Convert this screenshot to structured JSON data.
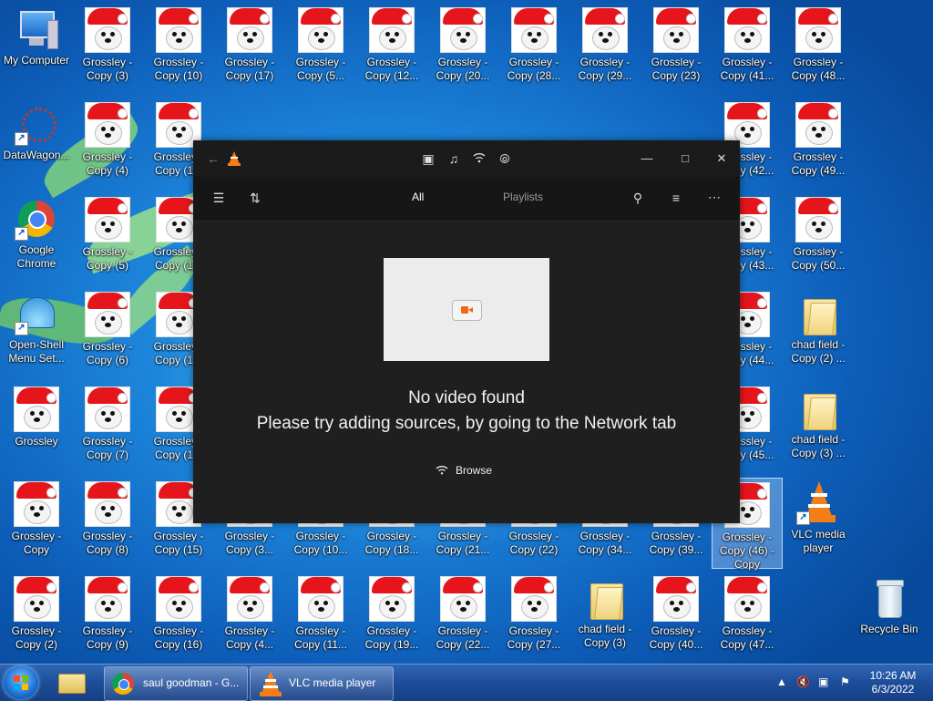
{
  "desktop": {
    "icons": [
      {
        "label": "My Computer",
        "kind": "computer"
      },
      {
        "label": "DataWagon...",
        "kind": "datawagon"
      },
      {
        "label": "Google Chrome",
        "kind": "chrome"
      },
      {
        "label": "Open-Shell Menu Set...",
        "kind": "shell"
      },
      {
        "label": "Grossley",
        "kind": "dog"
      },
      {
        "label": "Grossley - Copy",
        "kind": "dog"
      },
      {
        "label": "Grossley - Copy (2)",
        "kind": "dog"
      },
      {
        "label": "Grossley - Copy (3)",
        "kind": "dog"
      },
      {
        "label": "Grossley - Copy (4)",
        "kind": "dog"
      },
      {
        "label": "Grossley - Copy (5)",
        "kind": "dog"
      },
      {
        "label": "Grossley - Copy (6)",
        "kind": "dog"
      },
      {
        "label": "Grossley - Copy (7)",
        "kind": "dog"
      },
      {
        "label": "Grossley - Copy (8)",
        "kind": "dog"
      },
      {
        "label": "Grossley - Copy (9)",
        "kind": "dog"
      },
      {
        "label": "Grossley - Copy (10)",
        "kind": "dog"
      },
      {
        "label": "Grossley - Copy (1...",
        "kind": "dog"
      },
      {
        "label": "Grossley - Copy (1...",
        "kind": "dog"
      },
      {
        "label": "Grossley - Copy (1...",
        "kind": "dog"
      },
      {
        "label": "Grossley - Copy (1...",
        "kind": "dog"
      },
      {
        "label": "Grossley - Copy (15)",
        "kind": "dog"
      },
      {
        "label": "Grossley - Copy (16)",
        "kind": "dog"
      },
      {
        "label": "Grossley - Copy (17)",
        "kind": "dog"
      },
      {
        "label": "Grossley - Copy (3...",
        "kind": "dog"
      },
      {
        "label": "Grossley - Copy (4...",
        "kind": "dog"
      },
      {
        "label": "Grossley - Copy (5...",
        "kind": "dog"
      },
      {
        "label": "Grossley - Copy (10...",
        "kind": "dog"
      },
      {
        "label": "Grossley - Copy (11...",
        "kind": "dog"
      },
      {
        "label": "Grossley - Copy (12...",
        "kind": "dog"
      },
      {
        "label": "Grossley - Copy (18...",
        "kind": "dog"
      },
      {
        "label": "Grossley - Copy (19...",
        "kind": "dog"
      },
      {
        "label": "Grossley - Copy (20...",
        "kind": "dog"
      },
      {
        "label": "Grossley - Copy (21...",
        "kind": "dog"
      },
      {
        "label": "Grossley - Copy (22...",
        "kind": "dog"
      },
      {
        "label": "Grossley - Copy (22)",
        "kind": "dog"
      },
      {
        "label": "Grossley - Copy (27...",
        "kind": "dog"
      },
      {
        "label": "Grossley - Copy (28...",
        "kind": "dog"
      },
      {
        "label": "Grossley - Copy (29...",
        "kind": "dog"
      },
      {
        "label": "Grossley - Copy (34...",
        "kind": "dog"
      },
      {
        "label": "chad field - Copy (3)",
        "kind": "folder"
      },
      {
        "label": "Grossley - Copy (23)",
        "kind": "dog"
      },
      {
        "label": "Grossley - Copy (39...",
        "kind": "dog"
      },
      {
        "label": "Grossley - Copy (40...",
        "kind": "dog"
      },
      {
        "label": "Grossley - Copy (41...",
        "kind": "dog"
      },
      {
        "label": "Grossley - Copy (42...",
        "kind": "dog"
      },
      {
        "label": "Grossley - Copy (43...",
        "kind": "dog"
      },
      {
        "label": "Grossley - Copy (44...",
        "kind": "dog"
      },
      {
        "label": "Grossley - Copy (45...",
        "kind": "dog"
      },
      {
        "label": "Grossley - Copy (46) - Copy",
        "kind": "dog",
        "selected": true
      },
      {
        "label": "Grossley - Copy (47...",
        "kind": "dog"
      },
      {
        "label": "Grossley - Copy (48...",
        "kind": "dog"
      },
      {
        "label": "Grossley - Copy (49...",
        "kind": "dog"
      },
      {
        "label": "Grossley - Copy (50...",
        "kind": "dog"
      },
      {
        "label": "chad field - Copy (2) ...",
        "kind": "folder"
      },
      {
        "label": "chad field - Copy (3) ...",
        "kind": "folder"
      },
      {
        "label": "VLC media player",
        "kind": "vlc"
      },
      {
        "label": "Recycle Bin",
        "kind": "bin"
      }
    ]
  },
  "vlc_window": {
    "tabs": {
      "all": "All",
      "playlists": "Playlists"
    },
    "empty_title": "No video found",
    "empty_hint": "Please try adding sources, by going to the Network tab",
    "browse_label": "Browse",
    "colors": {
      "accent": "#f06a14",
      "background": "#1f1f1f"
    }
  },
  "taskbar": {
    "chrome_button": "saul goodman - G...",
    "vlc_button": "VLC media player",
    "time": "10:26 AM",
    "date": "6/3/2022"
  }
}
